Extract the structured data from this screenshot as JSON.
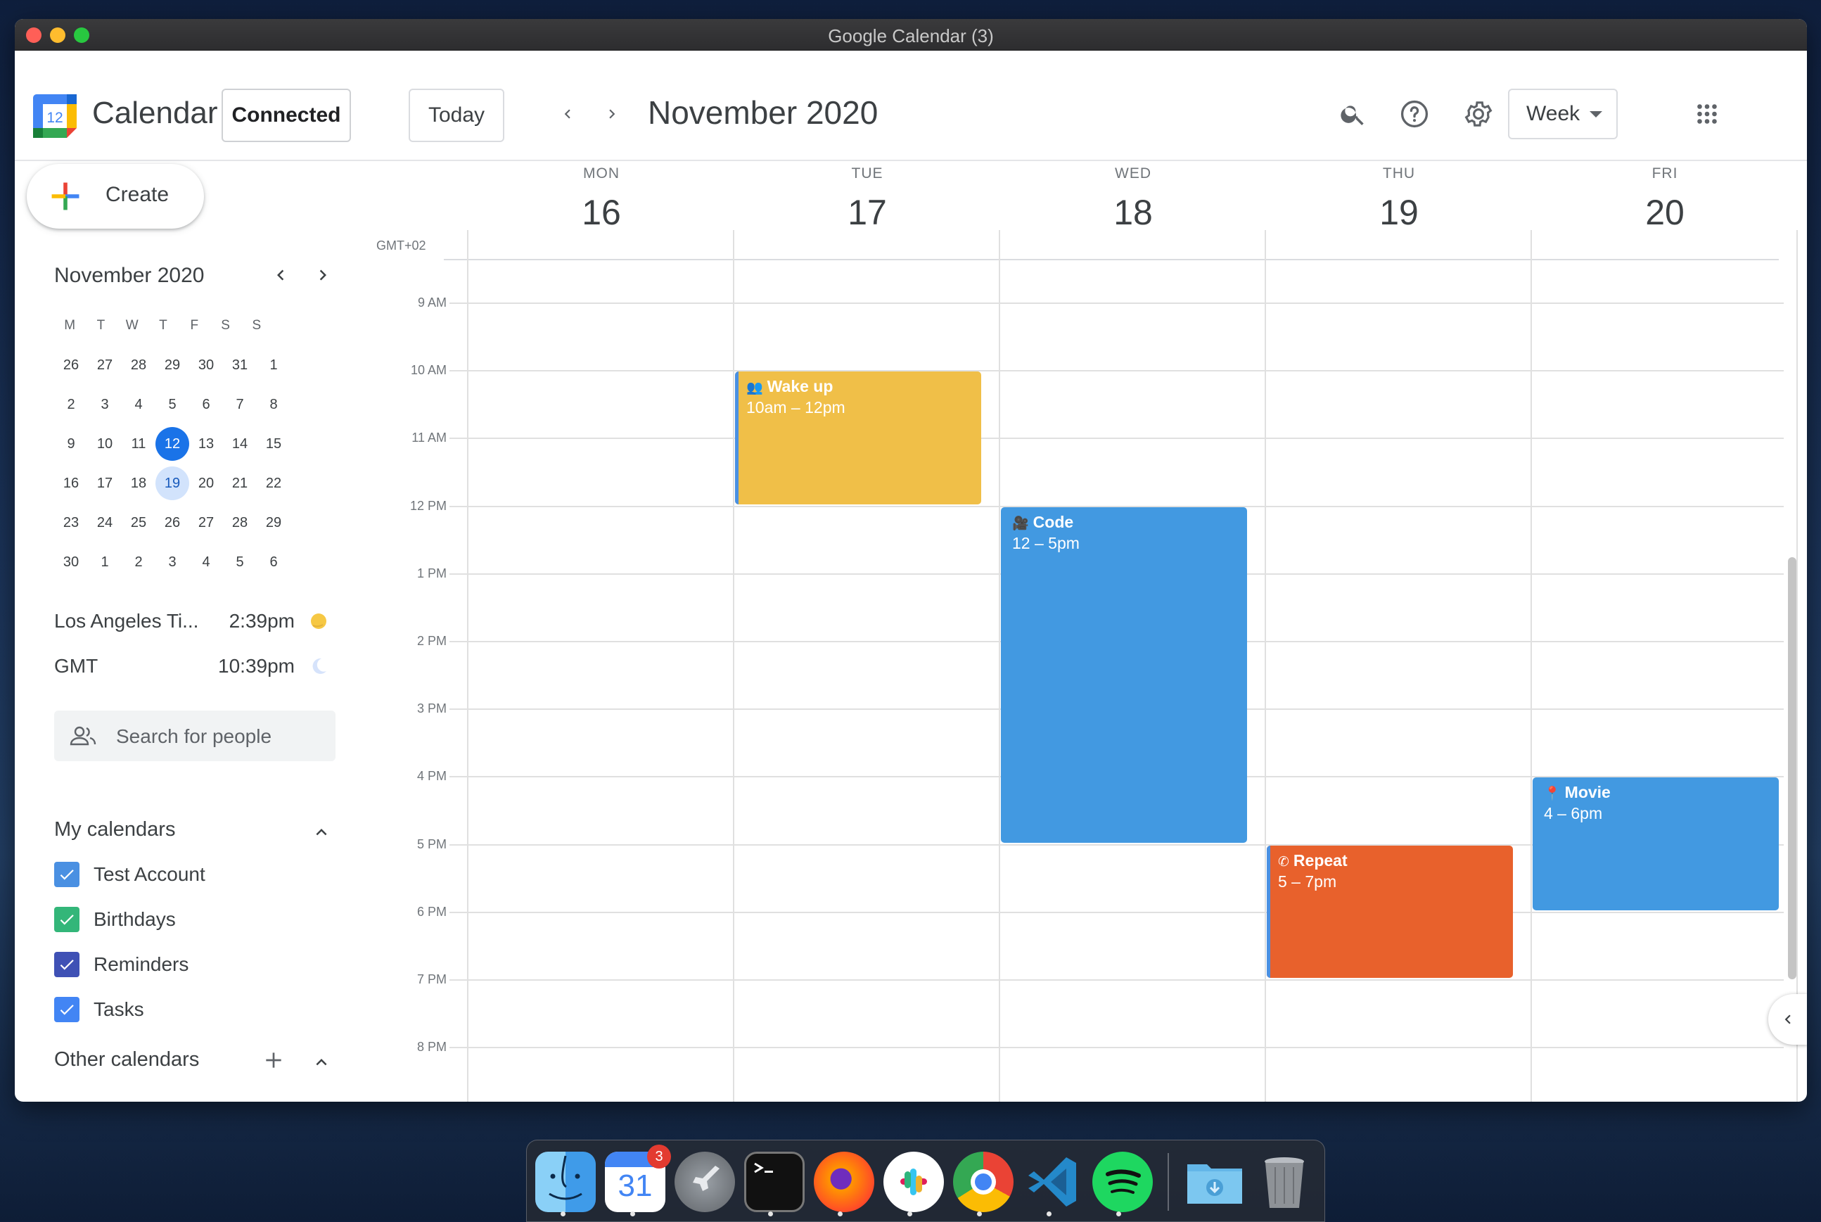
{
  "window": {
    "title": "Google Calendar (3)"
  },
  "header": {
    "app_name": "Calendar",
    "logo_day": "12",
    "connected_label": "Connected",
    "today_label": "Today",
    "month_title": "November 2020",
    "view_label": "Week",
    "icons": [
      "search-icon",
      "help-icon",
      "settings-icon",
      "apps-grid-icon"
    ]
  },
  "sidebar": {
    "create_label": "Create",
    "mini_calendar": {
      "title": "November 2020",
      "weekdays": [
        "M",
        "T",
        "W",
        "T",
        "F",
        "S",
        "S"
      ],
      "weeks": [
        [
          "26",
          "27",
          "28",
          "29",
          "30",
          "31",
          "1"
        ],
        [
          "2",
          "3",
          "4",
          "5",
          "6",
          "7",
          "8"
        ],
        [
          "9",
          "10",
          "11",
          "12",
          "13",
          "14",
          "15"
        ],
        [
          "16",
          "17",
          "18",
          "19",
          "20",
          "21",
          "22"
        ],
        [
          "23",
          "24",
          "25",
          "26",
          "27",
          "28",
          "29"
        ],
        [
          "30",
          "1",
          "2",
          "3",
          "4",
          "5",
          "6"
        ]
      ],
      "today": "12",
      "selected": "19"
    },
    "timezones": [
      {
        "name": "Los Angeles Ti...",
        "time": "2:39pm",
        "icon": "sun-icon"
      },
      {
        "name": "GMT",
        "time": "10:39pm",
        "icon": "moon-icon"
      }
    ],
    "search_placeholder": "Search for people",
    "my_calendars_label": "My calendars",
    "my_calendars": [
      {
        "name": "Test Account",
        "color": "#4a90e2"
      },
      {
        "name": "Birthdays",
        "color": "#33b679"
      },
      {
        "name": "Reminders",
        "color": "#3f51b5"
      },
      {
        "name": "Tasks",
        "color": "#4285f4"
      }
    ],
    "other_calendars_label": "Other calendars"
  },
  "week": {
    "timezone_label": "GMT+02",
    "days": [
      {
        "dow": "MON",
        "date": "16"
      },
      {
        "dow": "TUE",
        "date": "17"
      },
      {
        "dow": "WED",
        "date": "18"
      },
      {
        "dow": "THU",
        "date": "19"
      },
      {
        "dow": "FRI",
        "date": "20"
      }
    ],
    "hours": [
      "9 AM",
      "10 AM",
      "11 AM",
      "12 PM",
      "1 PM",
      "2 PM",
      "3 PM",
      "4 PM",
      "5 PM",
      "6 PM",
      "7 PM",
      "8 PM"
    ],
    "events": [
      {
        "title": "Wake up",
        "time": "10am – 12pm",
        "icon": "👥",
        "color": "#f0bf48"
      },
      {
        "title": "Code",
        "time": "12 – 5pm",
        "icon": "🎥",
        "color": "#4299e1"
      },
      {
        "title": "Repeat",
        "time": "5 – 7pm",
        "icon": "✆",
        "color": "#e8612c"
      },
      {
        "title": "Movie",
        "time": "4 – 6pm",
        "icon": "📍",
        "color": "#4299e1"
      }
    ]
  },
  "dock": {
    "apps": [
      "Finder",
      "Google Calendar",
      "Launchpad",
      "Terminal",
      "Firefox",
      "Slack",
      "Chrome",
      "VS Code",
      "Spotify",
      "Downloads",
      "Trash"
    ],
    "calendar_icon_day": "31",
    "calendar_badge": "3"
  }
}
